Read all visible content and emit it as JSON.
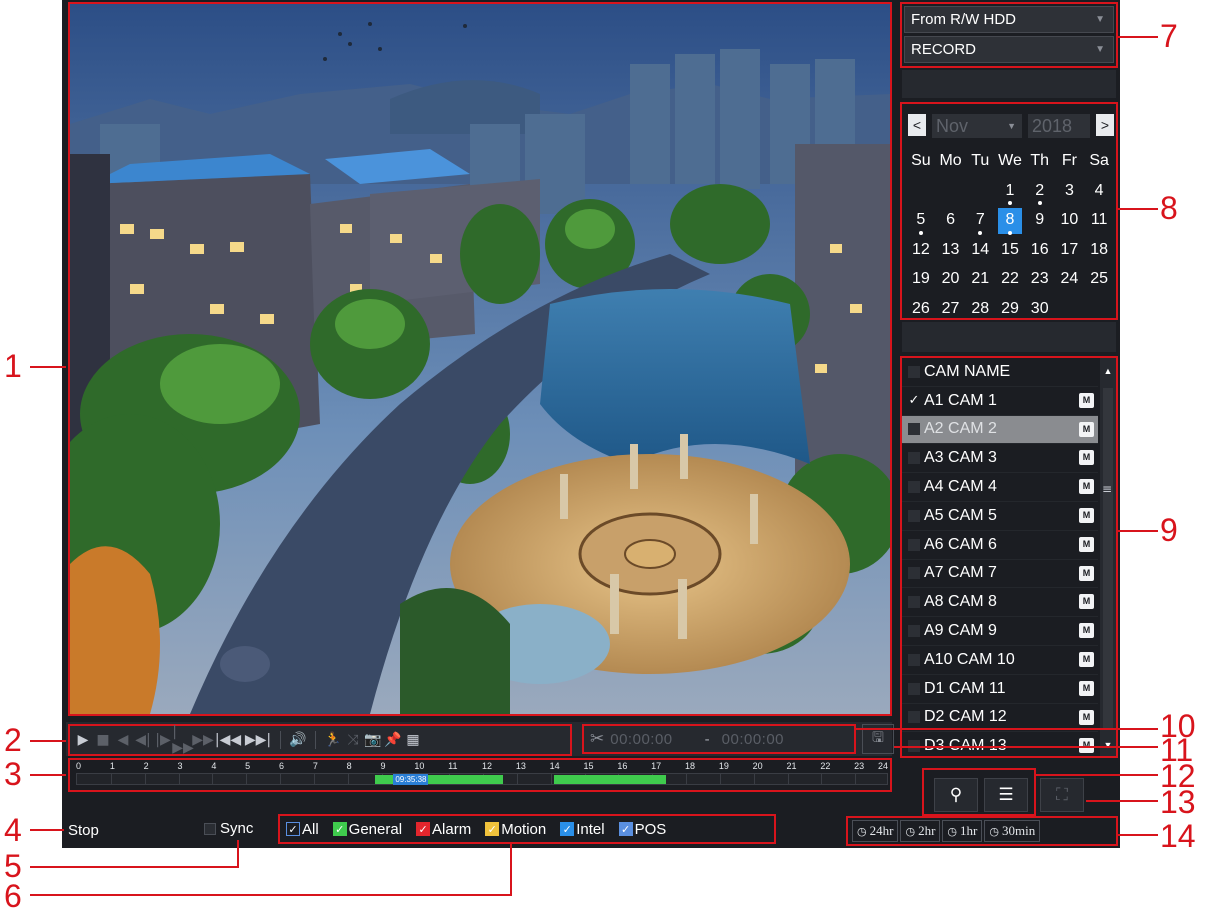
{
  "playback_controls": {
    "play": "▶",
    "stop": "■",
    "rewind": "◀",
    "prev_frame": "◀|",
    "next_frame": "|▶",
    "slow": "|▶▶",
    "fast": "▶▶",
    "previous": "|◀◀",
    "next": "▶▶|",
    "volume": "🔊",
    "smart_search": "🏃",
    "tag_search": "⤨",
    "snapshot": "📷",
    "mark": "📌",
    "pos": "▦"
  },
  "clip": {
    "start_time": "00:00:00",
    "separator": "-",
    "end_time": "00:00:00",
    "scissors": "✂",
    "save": "🖫"
  },
  "timeline": {
    "hours": [
      "0",
      "1",
      "2",
      "3",
      "4",
      "5",
      "6",
      "7",
      "8",
      "9",
      "10",
      "11",
      "12",
      "13",
      "14",
      "15",
      "16",
      "17",
      "18",
      "19",
      "20",
      "21",
      "22",
      "23",
      "24"
    ],
    "current_time": "09:35:38",
    "segments": [
      {
        "start": 8.8,
        "end": 12.6
      },
      {
        "start": 14.1,
        "end": 17.4
      }
    ]
  },
  "status": {
    "state": "Stop",
    "sync_label": "Sync"
  },
  "record_types": [
    {
      "label": "All",
      "color": "#2a8fe8",
      "checked": true
    },
    {
      "label": "General",
      "color": "#3fcb4d",
      "checked": true
    },
    {
      "label": "Alarm",
      "color": "#e3262d",
      "checked": true
    },
    {
      "label": "Motion",
      "color": "#f0c23c",
      "checked": true
    },
    {
      "label": "Intel",
      "color": "#2a8fe8",
      "checked": true
    },
    {
      "label": "POS",
      "color": "#5a8fe0",
      "checked": true
    }
  ],
  "source": {
    "storage": "From R/W HDD",
    "record_type": "RECORD"
  },
  "calendar": {
    "prev": "<",
    "next": ">",
    "month": "Nov",
    "year": "2018",
    "weekdays": [
      "Su",
      "Mo",
      "Tu",
      "We",
      "Th",
      "Fr",
      "Sa"
    ],
    "leading_blanks": 3,
    "days": [
      "1",
      "2",
      "3",
      "4",
      "5",
      "6",
      "7",
      "8",
      "9",
      "10",
      "11",
      "12",
      "13",
      "14",
      "15",
      "16",
      "17",
      "18",
      "19",
      "20",
      "21",
      "22",
      "23",
      "24",
      "25",
      "26",
      "27",
      "28",
      "29",
      "30"
    ],
    "recorded_days": [
      "1",
      "2",
      "5",
      "7",
      "8"
    ],
    "selected_day": "8"
  },
  "cameras": {
    "header": "CAM NAME",
    "items": [
      {
        "name": "A1 CAM 1",
        "checked": true,
        "selected": false
      },
      {
        "name": "A2 CAM 2",
        "checked": false,
        "selected": true
      },
      {
        "name": "A3 CAM 3",
        "checked": false,
        "selected": false
      },
      {
        "name": "A4 CAM 4",
        "checked": false,
        "selected": false
      },
      {
        "name": "A5 CAM 5",
        "checked": false,
        "selected": false
      },
      {
        "name": "A6 CAM 6",
        "checked": false,
        "selected": false
      },
      {
        "name": "A7 CAM 7",
        "checked": false,
        "selected": false
      },
      {
        "name": "A8 CAM 8",
        "checked": false,
        "selected": false
      },
      {
        "name": "A9 CAM 9",
        "checked": false,
        "selected": false
      },
      {
        "name": "A10 CAM 10",
        "checked": false,
        "selected": false
      },
      {
        "name": "D1 CAM 11",
        "checked": false,
        "selected": false
      },
      {
        "name": "D2 CAM 12",
        "checked": false,
        "selected": false
      },
      {
        "name": "D3 CAM 13",
        "checked": false,
        "selected": false
      }
    ],
    "main_stream_badge": "M",
    "scroll_up": "▲",
    "scroll_down": "▼",
    "scroll_grip": "≡"
  },
  "tools": {
    "search": "⚲",
    "list": "☰",
    "fullscreen": "⛶"
  },
  "periods": [
    {
      "clock": "◷",
      "label": "24hr"
    },
    {
      "clock": "◷",
      "label": "2hr"
    },
    {
      "clock": "◷",
      "label": "1hr"
    },
    {
      "clock": "◷",
      "label": "30min"
    }
  ],
  "callouts": [
    "1",
    "2",
    "3",
    "4",
    "5",
    "6",
    "7",
    "8",
    "9",
    "10",
    "11",
    "12",
    "13",
    "14"
  ],
  "dropdown_arrow": "▼",
  "colors": {
    "annotation": "#d8141c",
    "panel": "#1b1d22",
    "selection": "#2a8fe8",
    "recording": "#3fcb4d"
  }
}
